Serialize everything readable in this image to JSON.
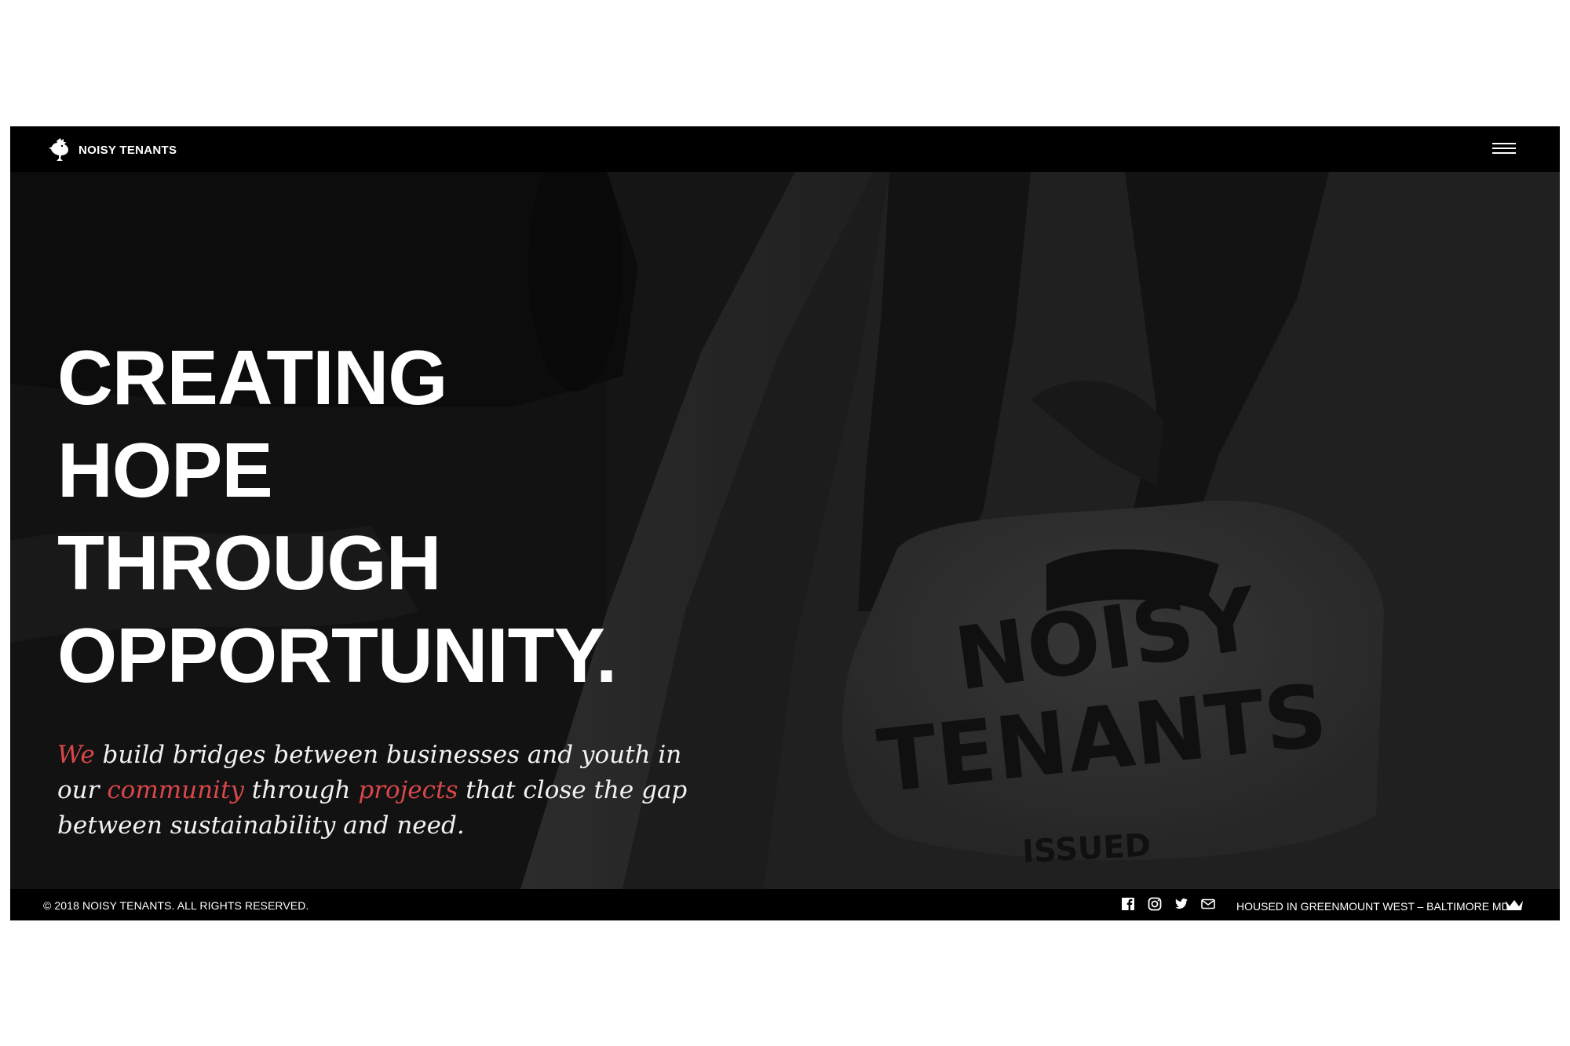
{
  "header": {
    "brand_name": "NOISY TENANTS",
    "menu_icon": "hamburger-menu-icon"
  },
  "hero": {
    "headline_lines": [
      "CREATING",
      "HOPE",
      "THROUGH",
      "OPPORTUNITY."
    ],
    "tagline": {
      "part1_highlight": "We",
      "part2": " build bridges between businesses and youth in our ",
      "part3_highlight": "community",
      "part4": " through ",
      "part5_highlight": "projects",
      "part6": " that close the gap between sustainability and need."
    },
    "bag_print": [
      "NOISY",
      "TENANTS",
      "ISSUED"
    ]
  },
  "footer": {
    "copyright": "© 2018 NOISY TENANTS. ALL RIGHTS RESERVED.",
    "socials": [
      "facebook-icon",
      "instagram-icon",
      "twitter-icon",
      "email-icon"
    ],
    "location": "HOUSED IN GREENMOUNT WEST – BALTIMORE MD",
    "crown_icon": "crown-icon"
  },
  "colors": {
    "accent": "#d9474a",
    "bar_background": "#000000",
    "hero_background": "#1d1d1d",
    "text": "#ffffff"
  }
}
